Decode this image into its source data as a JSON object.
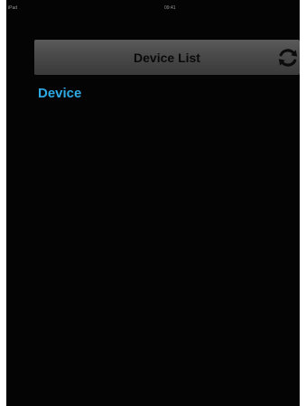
{
  "status_bar": {
    "carrier": "iPad",
    "time": "09:41"
  },
  "navbar": {
    "title": "Device List",
    "refresh_icon": "refresh-icon"
  },
  "section": {
    "label": "Device"
  },
  "colors": {
    "background": "#040404",
    "accent": "#2fa9e4",
    "navbar": "#4a4a4a"
  }
}
